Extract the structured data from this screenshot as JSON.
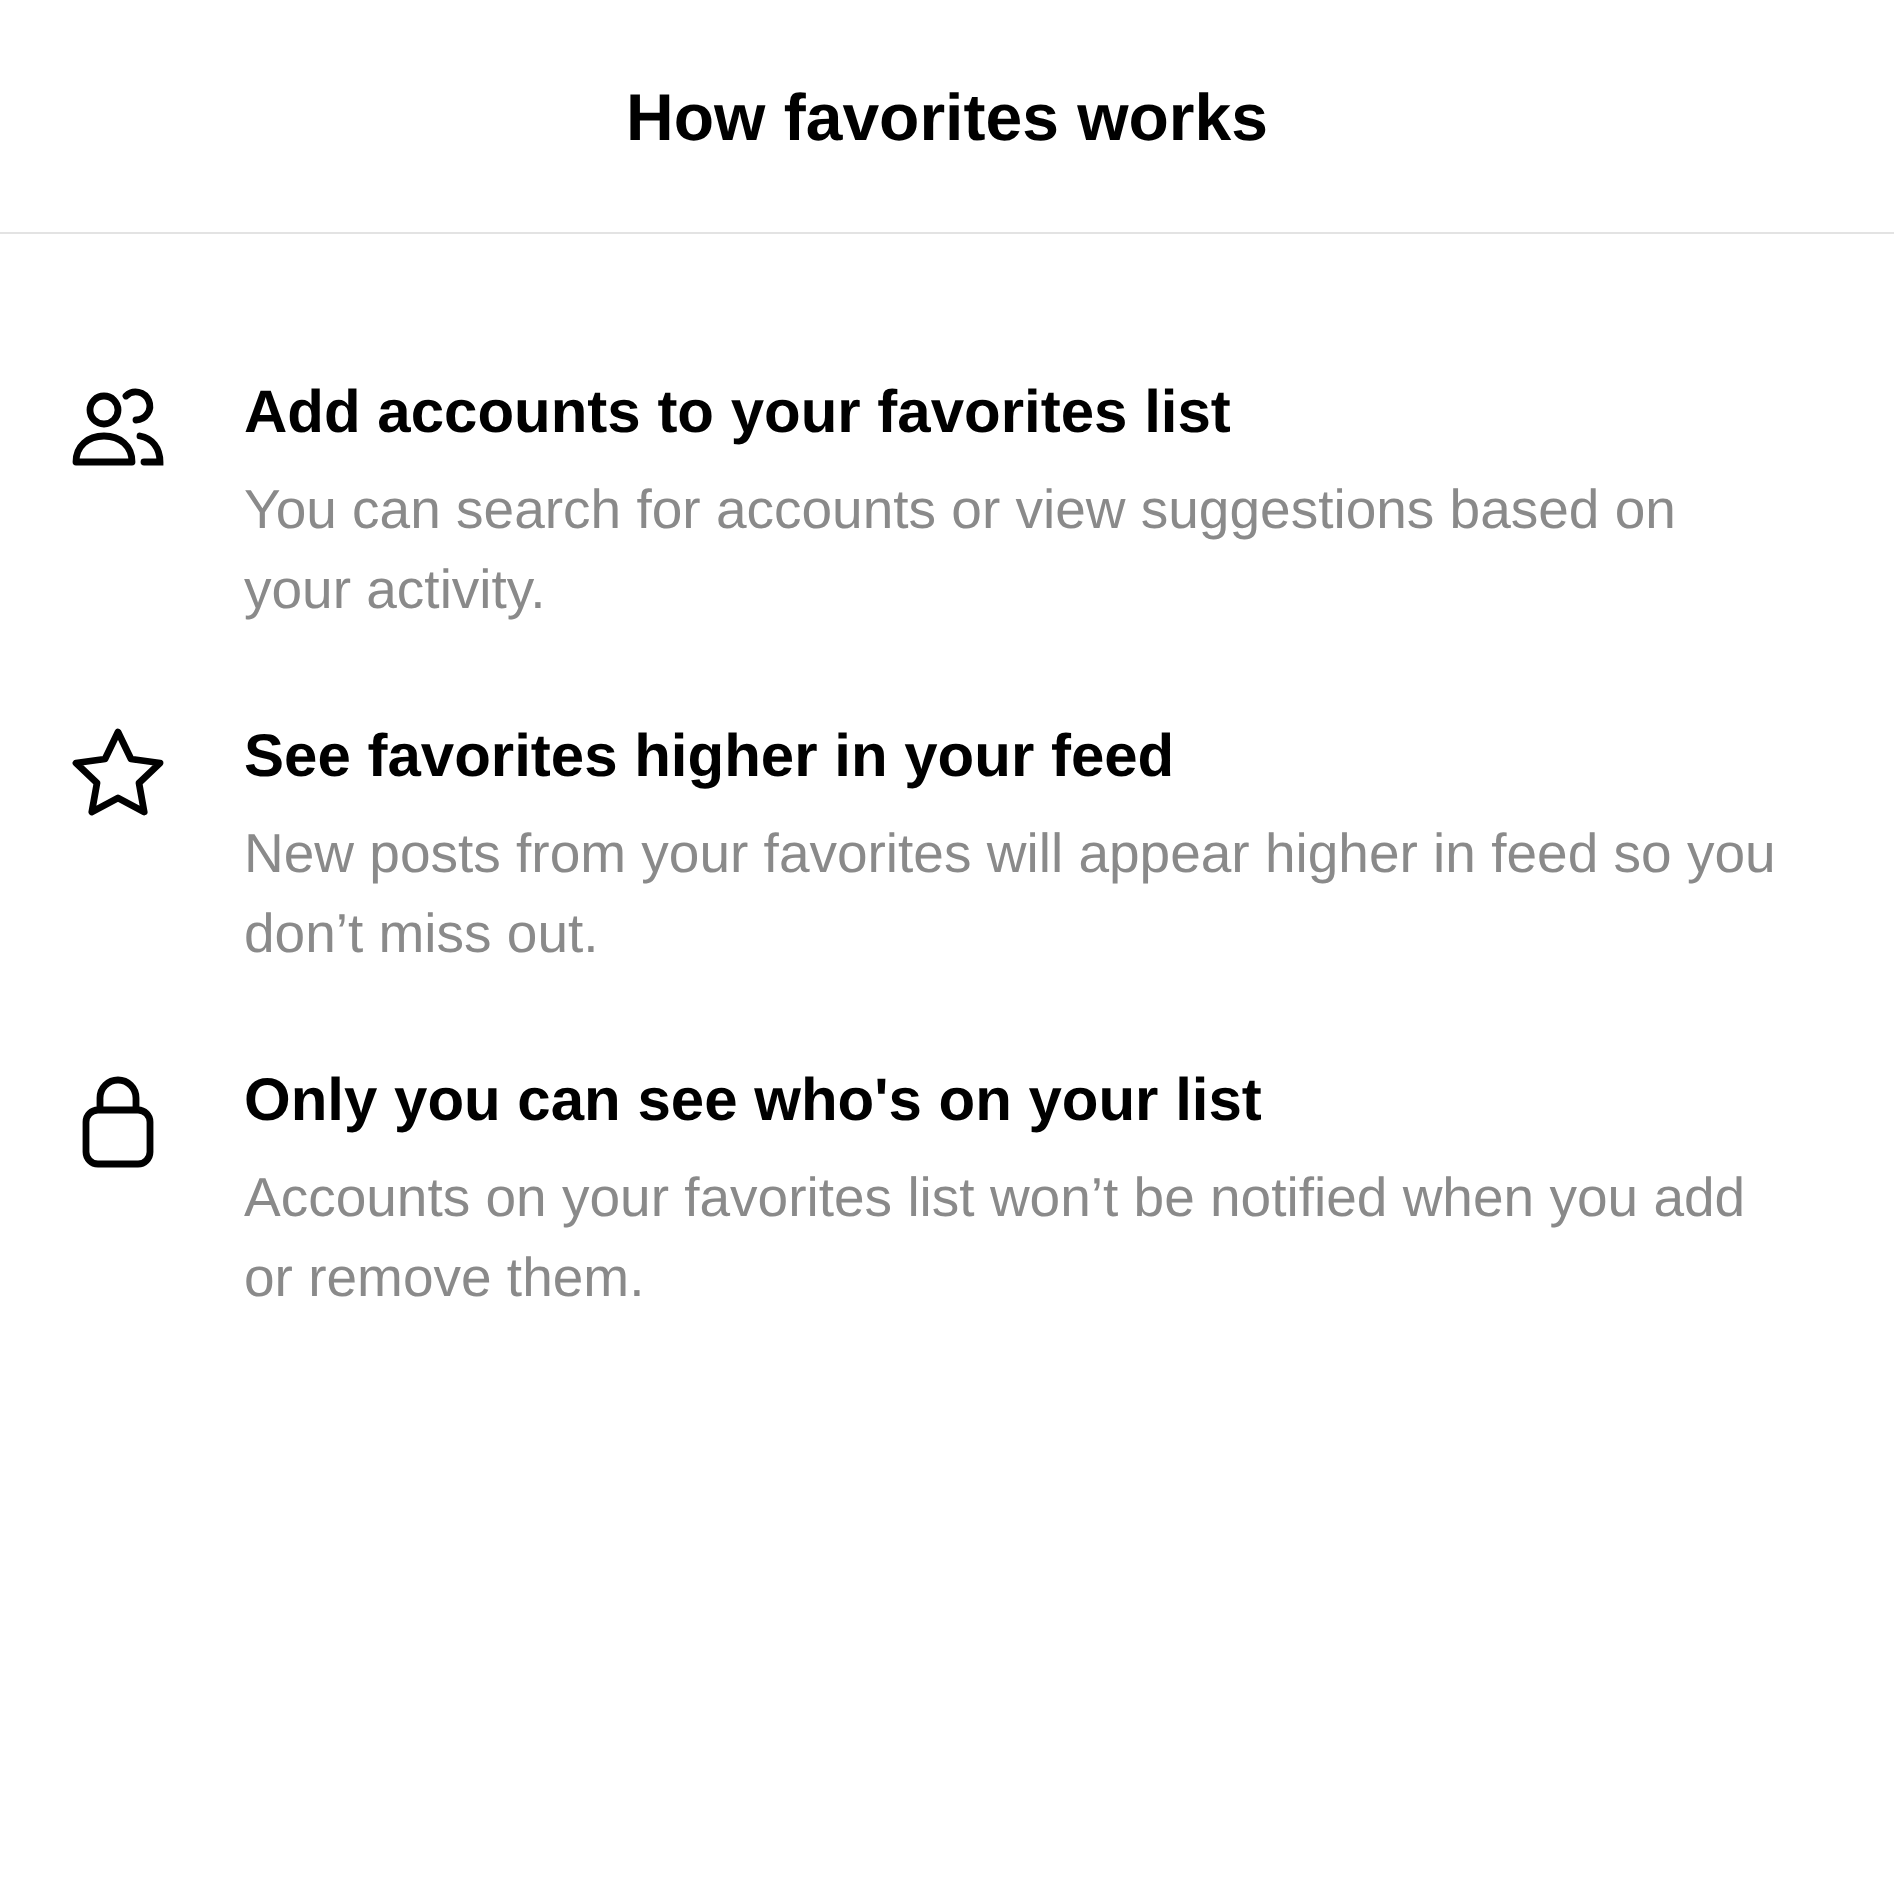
{
  "header": {
    "title": "How favorites works"
  },
  "items": [
    {
      "heading": "Add accounts to your favorites list",
      "description": "You can search for accounts or view suggestions based on your activity."
    },
    {
      "heading": "See favorites higher in your feed",
      "description": "New posts from your favorites will appear higher in feed so you don’t miss out."
    },
    {
      "heading": "Only you can see who's on your list",
      "description": "Accounts on your favorites list won’t be notified when you add or remove them."
    }
  ]
}
